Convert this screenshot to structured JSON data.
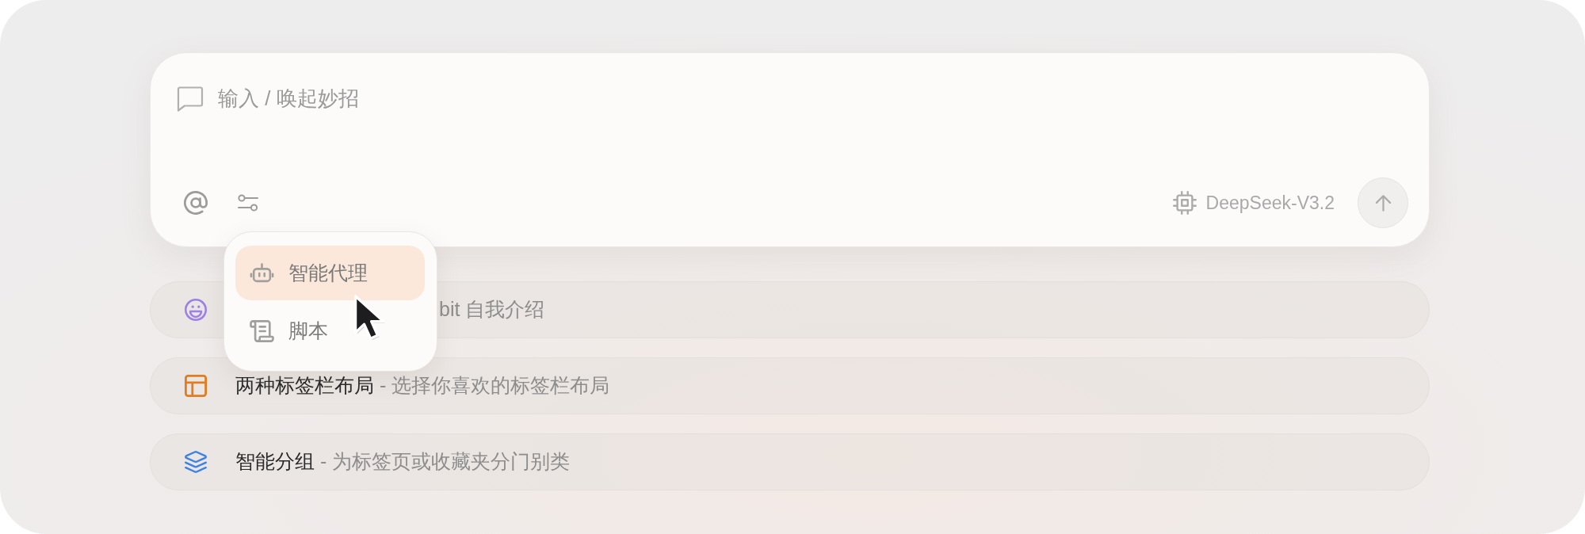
{
  "composer": {
    "placeholder": "输入 / 唤起妙招",
    "model": "DeepSeek-V3.2",
    "send_button": {
      "disabled": true
    }
  },
  "menu": {
    "items": [
      {
        "kind": "agent",
        "label": "智能代理",
        "selected": true
      },
      {
        "kind": "script",
        "label": "脚本",
        "selected": false
      }
    ]
  },
  "suggestions": [
    {
      "kind": "smile",
      "color": "#9d7fe8",
      "description": "bit 自我介绍"
    },
    {
      "kind": "layout",
      "color": "#e27c1e",
      "title": "两种标签栏布局",
      "description": "- 选择你喜欢的标签栏布局"
    },
    {
      "kind": "layers",
      "color": "#3d80e6",
      "title": "智能分组",
      "description": "- 为标签页或收藏夹分门别类"
    }
  ]
}
